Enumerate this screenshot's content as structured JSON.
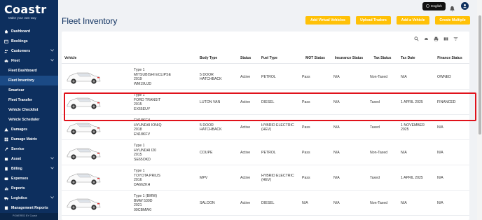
{
  "brand": {
    "name": "Coastr",
    "tagline": "Make your own way"
  },
  "sidebar": {
    "items": [
      {
        "label": "Dashboard",
        "icon": "home-icon",
        "level": 0,
        "chevron": false
      },
      {
        "label": "Bookings",
        "icon": "calendar-icon",
        "level": 0,
        "chevron": false
      },
      {
        "label": "Customers",
        "icon": "users-icon",
        "level": 0,
        "chevron": true
      },
      {
        "label": "Fleet",
        "icon": "car-icon",
        "level": 0,
        "chevron": true
      },
      {
        "label": "Fleet Dashboard",
        "icon": "",
        "level": 1,
        "chevron": false
      },
      {
        "label": "Fleet Inventory",
        "icon": "",
        "level": 1,
        "chevron": false,
        "active": true
      },
      {
        "label": "Smartcar",
        "icon": "",
        "level": 1,
        "chevron": false
      },
      {
        "label": "Fleet Transfer",
        "icon": "",
        "level": 1,
        "chevron": false
      },
      {
        "label": "Vehicle Checklist",
        "icon": "",
        "level": 1,
        "chevron": false
      },
      {
        "label": "Vehicle Scheduler",
        "icon": "",
        "level": 1,
        "chevron": false
      },
      {
        "label": "Damages",
        "icon": "warning-icon",
        "level": 0,
        "chevron": false
      },
      {
        "label": "Damage Matrix",
        "icon": "grid-icon",
        "level": 0,
        "chevron": false
      },
      {
        "label": "Service",
        "icon": "wrench-icon",
        "level": 0,
        "chevron": false
      },
      {
        "label": "Asset",
        "icon": "box-icon",
        "level": 0,
        "chevron": true
      },
      {
        "label": "Billing",
        "icon": "invoice-icon",
        "level": 0,
        "chevron": true
      },
      {
        "label": "Expenses",
        "icon": "wallet-icon",
        "level": 0,
        "chevron": false
      },
      {
        "label": "Reports",
        "icon": "chart-icon",
        "level": 0,
        "chevron": false
      },
      {
        "label": "Logistics",
        "icon": "truck-icon",
        "level": 0,
        "chevron": true
      },
      {
        "label": "Management Reports",
        "icon": "report-icon",
        "level": 0,
        "chevron": false
      }
    ],
    "footer": "POWERED BY Coastr"
  },
  "header": {
    "language": "English"
  },
  "page": {
    "title": "Fleet Inventory"
  },
  "actions": [
    {
      "label": "Add Virtual Vehicles"
    },
    {
      "label": "Upload Traders"
    },
    {
      "label": "Add a Vehicle"
    },
    {
      "label": "Create Multiple"
    }
  ],
  "table": {
    "columns": [
      "Vehicle",
      "Body Type",
      "Status",
      "Fuel Type",
      "MOT Status",
      "Insurance Status",
      "Tax Status",
      "Tax Date",
      "Finance Status"
    ],
    "rows": [
      {
        "info": "Type 1\nMITSUBISHI ECLIPSE\n2019\nWM19UJD",
        "body": "5 DOOR\nHATCHBACK",
        "status": "Active",
        "fuel": "PETROL",
        "mot": "Pass",
        "insurance": "N/A",
        "tax": "Non-Taxed",
        "tax_date": "N/A",
        "finance": "OWNED"
      },
      {
        "info": "Type 1\nFORD TRANSIT\n2015\nEX65EUY",
        "body": "LUTON VAN",
        "status": "Active",
        "fuel": "DIESEL",
        "mot": "Pass",
        "insurance": "N/A",
        "tax": "Taxed",
        "tax_date": "1 APRIL 2025",
        "finance": "FINANCED"
      },
      {
        "info": "EN18KFV\nHYUNDAI IONIQ\n2018\nEN18KFV",
        "body": "5 DOOR\nHATCHBACK",
        "status": "Active",
        "fuel": "HYBRID ELECTRIC\n(HEV)",
        "mot": "Pass",
        "insurance": "N/A",
        "tax": "Taxed",
        "tax_date": "1 NOVEMBER\n2025",
        "finance": "N/A"
      },
      {
        "info": "Type 1\nHYUNDAI I20\n2015\nSE65OKD",
        "body": "COUPE",
        "status": "Active",
        "fuel": "PETROL",
        "mot": "Pass",
        "insurance": "N/A",
        "tax": "Non-Taxed",
        "tax_date": "N/A",
        "finance": "N/A"
      },
      {
        "info": "Type 1\nTOYOTA PRIUS\n2016\nDA66ZKH",
        "body": "MPV",
        "status": "Active",
        "fuel": "HYBRID ELECTRIC\n(HEV)",
        "mot": "Pass",
        "insurance": "N/A",
        "tax": "Taxed",
        "tax_date": "1 APRIL 2025",
        "finance": "N/A"
      },
      {
        "info": "Type 1 (BMW)\nBMW 530D\n2021\n09CBMW0",
        "body": "SALOON",
        "status": "Active",
        "fuel": "DIESEL",
        "mot": "N/A",
        "insurance": "N/A",
        "tax": "Non-Taxed",
        "tax_date": "N/A",
        "finance": "N/A"
      }
    ]
  },
  "colors": {
    "sidebar": "#0d2f5e",
    "accent": "#ffc107",
    "highlight": "#e0121b"
  }
}
